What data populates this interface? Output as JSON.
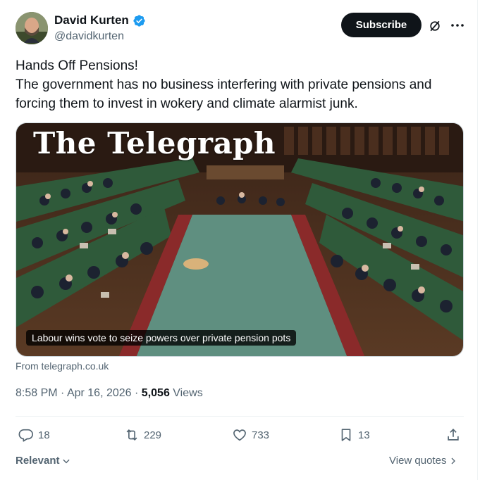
{
  "author": {
    "name": "David Kurten",
    "handle": "@davidkurten",
    "verified_color": "#1d9bf0"
  },
  "header": {
    "subscribe_label": "Subscribe",
    "grok_icon": "grok-icon",
    "more_icon": "more-icon"
  },
  "tweet": {
    "line1": "Hands Off Pensions!",
    "line2": "The government has no business interfering with private pensions and",
    "line3": "forcing them to invest in wokery and climate alarmist junk."
  },
  "card": {
    "masthead": "The Telegraph",
    "caption": "Labour wins vote to seize powers over private pension pots",
    "source": "From telegraph.co.uk"
  },
  "meta": {
    "time": "8:58 PM",
    "date": "Apr 16, 2026",
    "views_count": "5,056",
    "views_label": "Views"
  },
  "actions": {
    "replies": "18",
    "reposts": "229",
    "likes": "733",
    "bookmarks": "13"
  },
  "footer": {
    "relevant_label": "Relevant",
    "view_quotes_label": "View quotes"
  },
  "colors": {
    "text": "#0f1419",
    "muted": "#536471",
    "button_bg": "#0f1419",
    "carpet": "#5f8f80"
  }
}
